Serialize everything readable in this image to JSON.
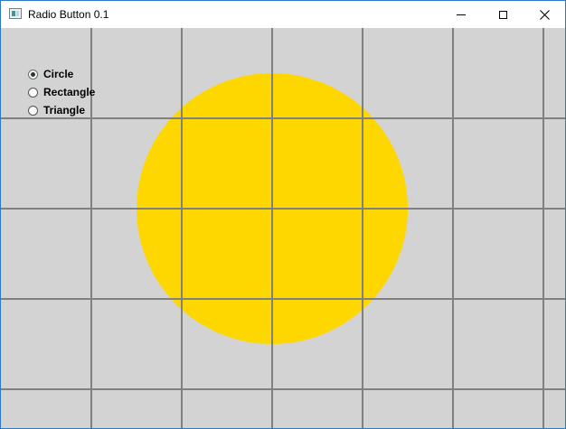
{
  "window": {
    "title": "Radio Button 0.1",
    "icons": {
      "app": "app-window-icon",
      "minimize": "minimize-icon",
      "maximize": "maximize-icon",
      "close": "close-icon"
    },
    "close_glyph": "✕"
  },
  "canvas": {
    "background": "#d3d3d3",
    "grid_color": "#808080",
    "shape": {
      "type": "circle",
      "color": "#ffd700"
    }
  },
  "radio_options": [
    {
      "label": "Circle",
      "selected": true
    },
    {
      "label": "Rectangle",
      "selected": false
    },
    {
      "label": "Triangle",
      "selected": false
    }
  ]
}
